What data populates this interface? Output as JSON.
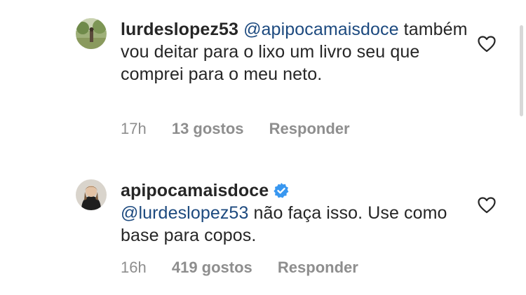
{
  "comments": [
    {
      "username": "lurdeslopez53",
      "mention": "@apipocamaisdoce",
      "text": "também  vou deitar para o lixo um livro seu que comprei para o meu neto.",
      "time": "17h",
      "likes": "13 gostos",
      "reply": "Responder",
      "verified": false,
      "avatar_icon": "avatar-outdoor-photo"
    },
    {
      "username": "apipocamaisdoce",
      "mention": "@lurdeslopez53",
      "text": "não faça isso. Use como base para copos.",
      "time": "16h",
      "likes": "419 gostos",
      "reply": "Responder",
      "verified": true,
      "avatar_icon": "avatar-woman-photo"
    }
  ],
  "colors": {
    "mention": "#1d4a7f",
    "meta": "#8e8e8e",
    "verified": "#3897f0",
    "text": "#262626"
  },
  "icons": {
    "like": "heart-outline-icon",
    "verified": "verified-badge-icon"
  }
}
